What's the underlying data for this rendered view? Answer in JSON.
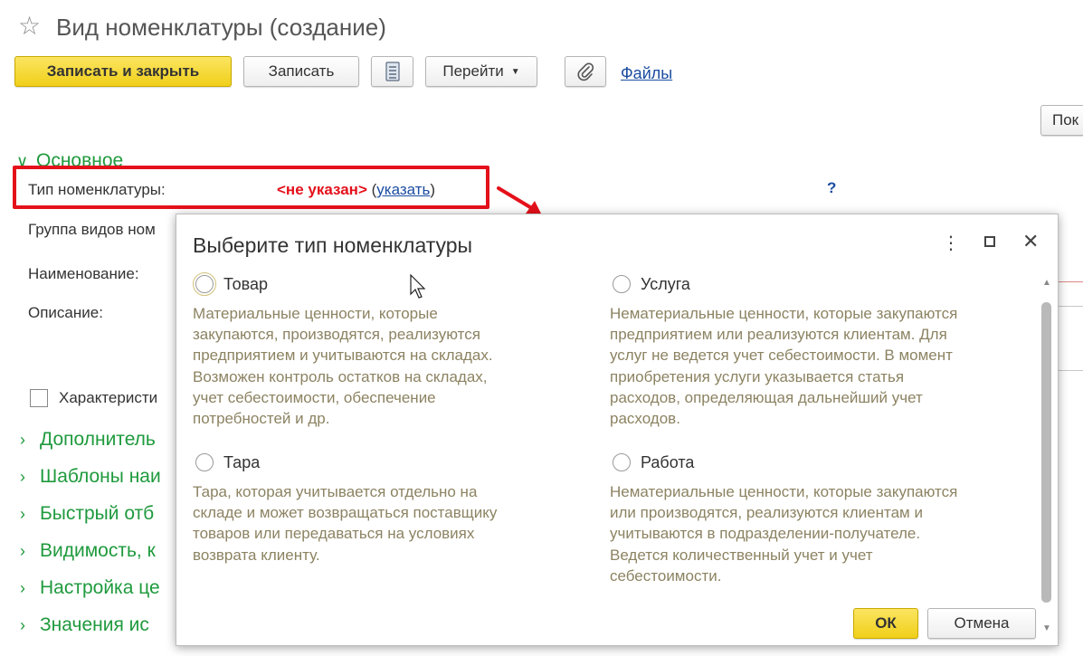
{
  "window": {
    "title": "Вид номенклатуры (создание)"
  },
  "toolbar": {
    "save_close": "Записать и закрыть",
    "save": "Записать",
    "goto": "Перейти",
    "files": "Файлы",
    "right_button": "Пок"
  },
  "form": {
    "section_main": "Основное",
    "type_label": "Тип номенклатуры:",
    "type_value": "<не указан>",
    "paren_open": "(",
    "type_link": "указать",
    "paren_close": ")",
    "help": "?",
    "group_label": "Группа видов ном",
    "name_label": "Наименование:",
    "description_label": "Описание:",
    "characteristics_label": "Характеристи",
    "sections": [
      "Дополнитель",
      "Шаблоны наи",
      "Быстрый отб",
      "Видимость, к",
      "Настройка це",
      "Значения  ис"
    ]
  },
  "dialog": {
    "title": "Выберите тип номенклатуры",
    "options": [
      {
        "label": "Товар",
        "description": "Материальные ценности, которые\nзакупаются, производятся, реализуются\nпредприятием и учитываются на складах.\nВозможен контроль остатков на складах,\nучет себестоимости, обеспечение\nпотребностей и др."
      },
      {
        "label": "Услуга",
        "description": "Нематериальные ценности, которые закупаются\nпредприятием или реализуются клиентам. Для\nуслуг не ведется учет себестоимости. В момент\nприобретения услуги указывается статья\nрасходов, определяющая дальнейший учет\nрасходов."
      },
      {
        "label": "Тара",
        "description": "Тара, которая учитывается отдельно на\nскладе и может возвращаться поставщику\nтоваров или передаваться на условиях\nвозврата клиенту."
      },
      {
        "label": "Работа",
        "description": "Нематериальные ценности, которые закупаются\nили производятся, реализуются клиентам и\nучитываются в подразделении-получателе.\nВедется количественный учет и учет\nсебестоимости."
      }
    ],
    "ok": "ОК",
    "cancel": "Отмена"
  },
  "colors": {
    "accent_yellow": "#f0cf19",
    "section_green": "#1f9a3d",
    "alert_red": "#e4111b",
    "link_blue": "#1c4da1",
    "description_text": "#8c8362"
  }
}
